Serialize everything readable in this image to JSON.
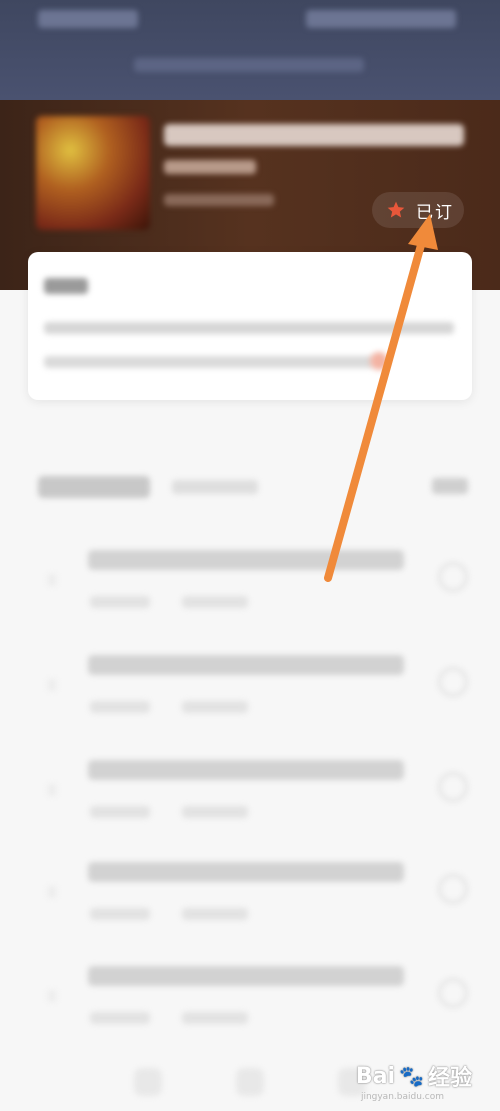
{
  "subscribe": {
    "label": "已订",
    "icon": "star-icon",
    "icon_color": "#e8573a"
  },
  "watermark": {
    "brand_left": "Bai",
    "brand_right": "经验",
    "paw_icon": "paw-icon",
    "site": "jingyan.baidu.com"
  },
  "colors": {
    "top_bar": "#464e6a",
    "header_bg": "#4b2a1a",
    "arrow": "#f08a3a",
    "page_bg": "#f7f7f7"
  },
  "episodes_count": 5
}
